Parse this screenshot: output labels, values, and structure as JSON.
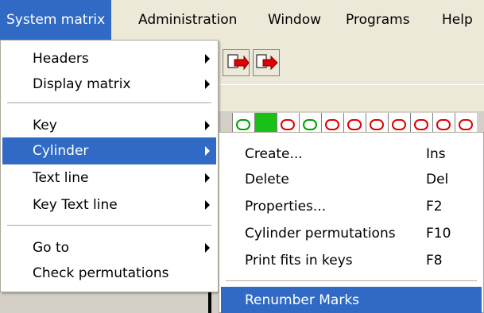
{
  "menubar": {
    "items": [
      "System matrix",
      "Administration",
      "Window",
      "Programs",
      "Help"
    ]
  },
  "system_menu": {
    "items": [
      {
        "label": "Headers",
        "submenu": true
      },
      {
        "label": "Display matrix",
        "submenu": true
      },
      {
        "label": "Key",
        "submenu": true
      },
      {
        "label": "Cylinder",
        "submenu": true
      },
      {
        "label": "Text line",
        "submenu": true
      },
      {
        "label": "Key Text line",
        "submenu": true
      },
      {
        "label": "Go to",
        "submenu": true
      },
      {
        "label": "Check permutations",
        "submenu": false
      }
    ]
  },
  "cylinder_menu": {
    "items": [
      {
        "label": "Create...",
        "shortcut": "Ins"
      },
      {
        "label": "Delete",
        "shortcut": "Del"
      },
      {
        "label": "Properties...",
        "shortcut": "F2"
      },
      {
        "label": "Cylinder permutations",
        "shortcut": "F10"
      },
      {
        "label": "Print fits in keys",
        "shortcut": "F8"
      },
      {
        "label": "Renumber Marks",
        "shortcut": ""
      }
    ]
  },
  "colors": {
    "highlight": "#316ac5",
    "menu_bg": "#ffffff",
    "chrome": "#ece9d8"
  }
}
